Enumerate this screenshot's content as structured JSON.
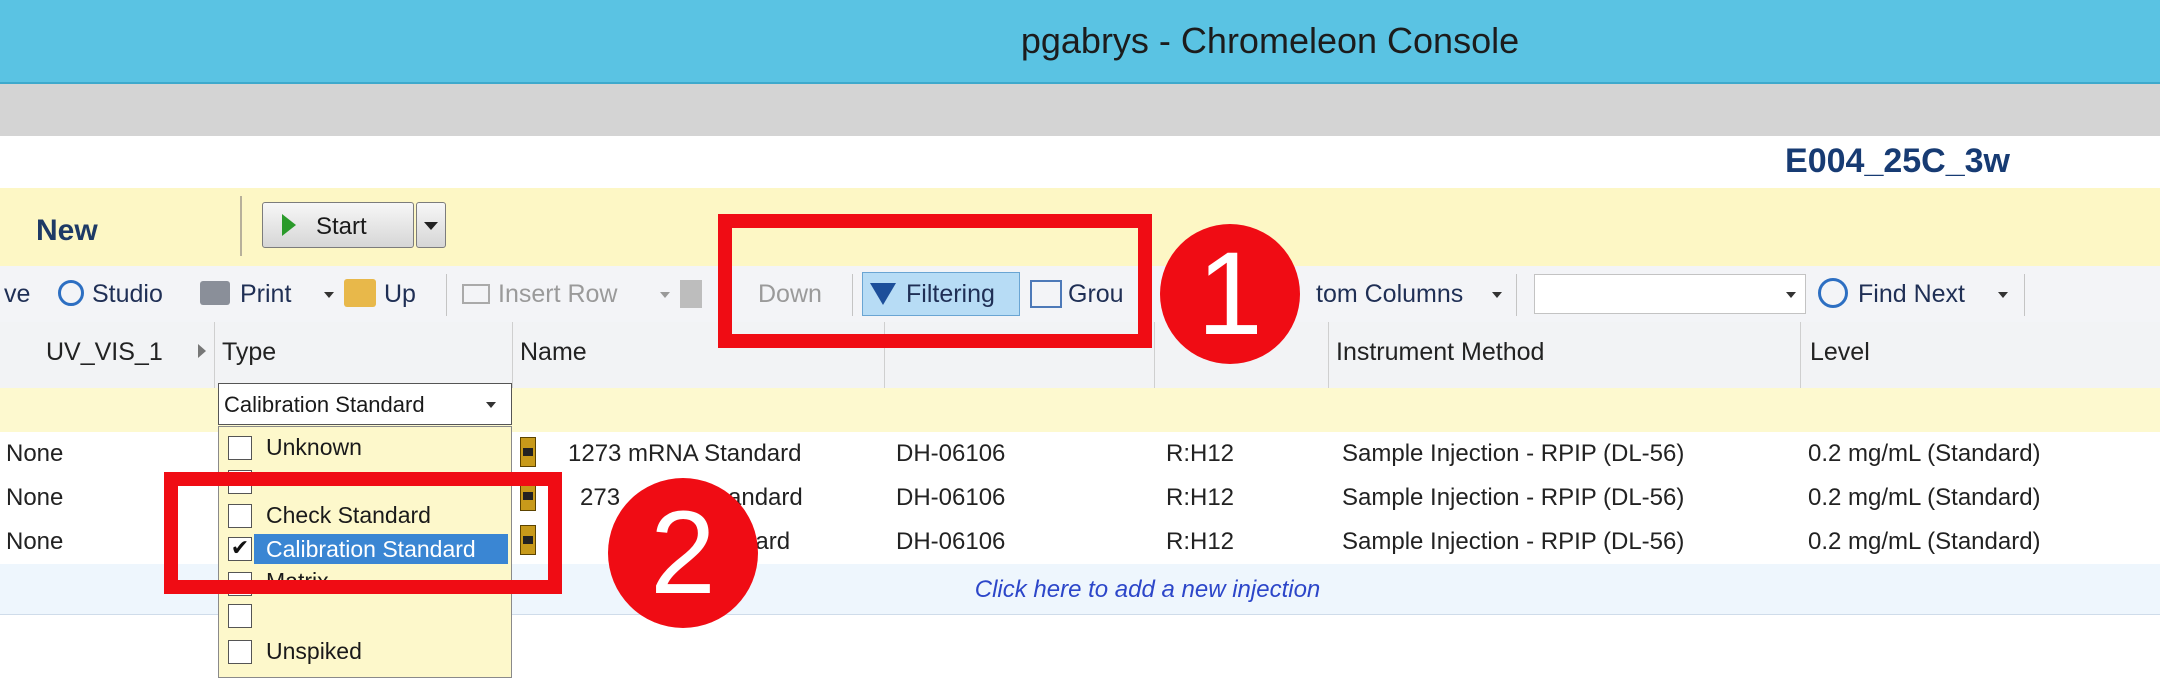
{
  "window": {
    "title": "pgabrys - Chromeleon Console"
  },
  "sequence": {
    "name": "E004_25C_3w"
  },
  "command_bar": {
    "new_label": "New",
    "start_label": "Start"
  },
  "toolbar": {
    "save_partial": "ve",
    "studio": "Studio",
    "print": "Print",
    "up": "Up",
    "insert_row": "Insert Row",
    "down": "Down",
    "filtering": "Filtering",
    "group_partial": "Grou",
    "custom_columns_partial": "tom Columns",
    "find_next": "Find Next"
  },
  "grid": {
    "headers": {
      "channel": "UV_VIS_1",
      "type": "Type",
      "name": "Name",
      "instrument_method": "Instrument Method",
      "level": "Level"
    },
    "type_filter_value": "Calibration Standard",
    "rows": [
      {
        "channel": "None",
        "name": "1273 mRNA Standard",
        "id": "DH-06106",
        "position": "R:H12",
        "method": "Sample Injection - RPIP (DL-56)",
        "level": "0.2 mg/mL (Standard)"
      },
      {
        "channel": "None",
        "name_left": "273",
        "name_right": "andard",
        "id": "DH-06106",
        "position": "R:H12",
        "method": "Sample Injection - RPIP (DL-56)",
        "level": "0.2 mg/mL (Standard)"
      },
      {
        "channel": "None",
        "name_left": "27",
        "name_right": "dard",
        "id": "DH-06106",
        "position": "R:H12",
        "method": "Sample Injection - RPIP (DL-56)",
        "level": "0.2 mg/mL (Standard)"
      }
    ],
    "new_row_text": "Click here to add a new injection"
  },
  "type_options": [
    {
      "label": "Unknown",
      "checked": false
    },
    {
      "label": "Check Standard",
      "checked": false
    },
    {
      "label": "Calibration Standard",
      "checked": true
    },
    {
      "label": "Matrix",
      "checked": false
    },
    {
      "label": "Unspiked",
      "checked": false
    }
  ],
  "annotations": {
    "step1": "1",
    "step2": "2"
  },
  "colors": {
    "titlebar": "#5ac3e3",
    "command_bar": "#fdf7c5",
    "annotation_red": "#f00c14",
    "selection": "#3a86d3"
  }
}
